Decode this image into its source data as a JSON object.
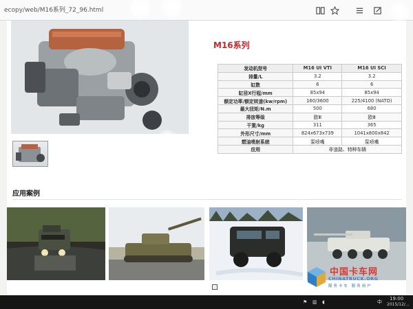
{
  "browser": {
    "url": "ecopy/web/M16系列_72_96.html",
    "icons": [
      "book-icon",
      "star-icon",
      "menu-icon",
      "edit-icon"
    ]
  },
  "product": {
    "series_title": "M16系列",
    "table": {
      "headers": [
        "发动机型号",
        "M16 UI VTI",
        "M16 UI SCI"
      ],
      "rows": [
        {
          "label": "排量/L",
          "vti": "3.2",
          "sci": "3.2"
        },
        {
          "label": "缸数",
          "vti": "6",
          "sci": "6"
        },
        {
          "label": "缸径X行程/mm",
          "vti": "85x94",
          "sci": "85x94"
        },
        {
          "label": "额定功率/额定转速(kw/rpm)",
          "vti": "160/3600",
          "sci": "225/4100 (NATO)"
        },
        {
          "label": "最大扭矩/N.m",
          "vti": "500",
          "sci": "680"
        },
        {
          "label": "排放等级",
          "vti": "欧Ⅲ",
          "sci": "欧Ⅲ"
        },
        {
          "label": "干重/kg",
          "vti": "311",
          "sci": "365"
        },
        {
          "label": "外形尺寸/mm",
          "vti": "824x673x739",
          "sci": "1041x800x842"
        },
        {
          "label": "燃油喷射系统",
          "vti": "泵喷嘴",
          "sci": "泵喷嘴"
        },
        {
          "label": "应用",
          "merged": "非道路、特种车辆"
        }
      ]
    }
  },
  "applications": {
    "title": "应用案例",
    "images": [
      "armored-vehicle-in-water",
      "light-tank-on-road",
      "armored-truck-in-snow",
      "wheeled-armored-vehicle"
    ]
  },
  "taskbar": {
    "lang": "中",
    "time": "19:00",
    "date": "2015/12/..."
  },
  "watermark": {
    "cn": "中国卡车网",
    "en": "CHINATRUCK.ORG",
    "sub": "服务卡车 服务用户"
  },
  "colors": {
    "accent_red": "#c8262a",
    "watermark_blue": "#3b7bbf"
  }
}
